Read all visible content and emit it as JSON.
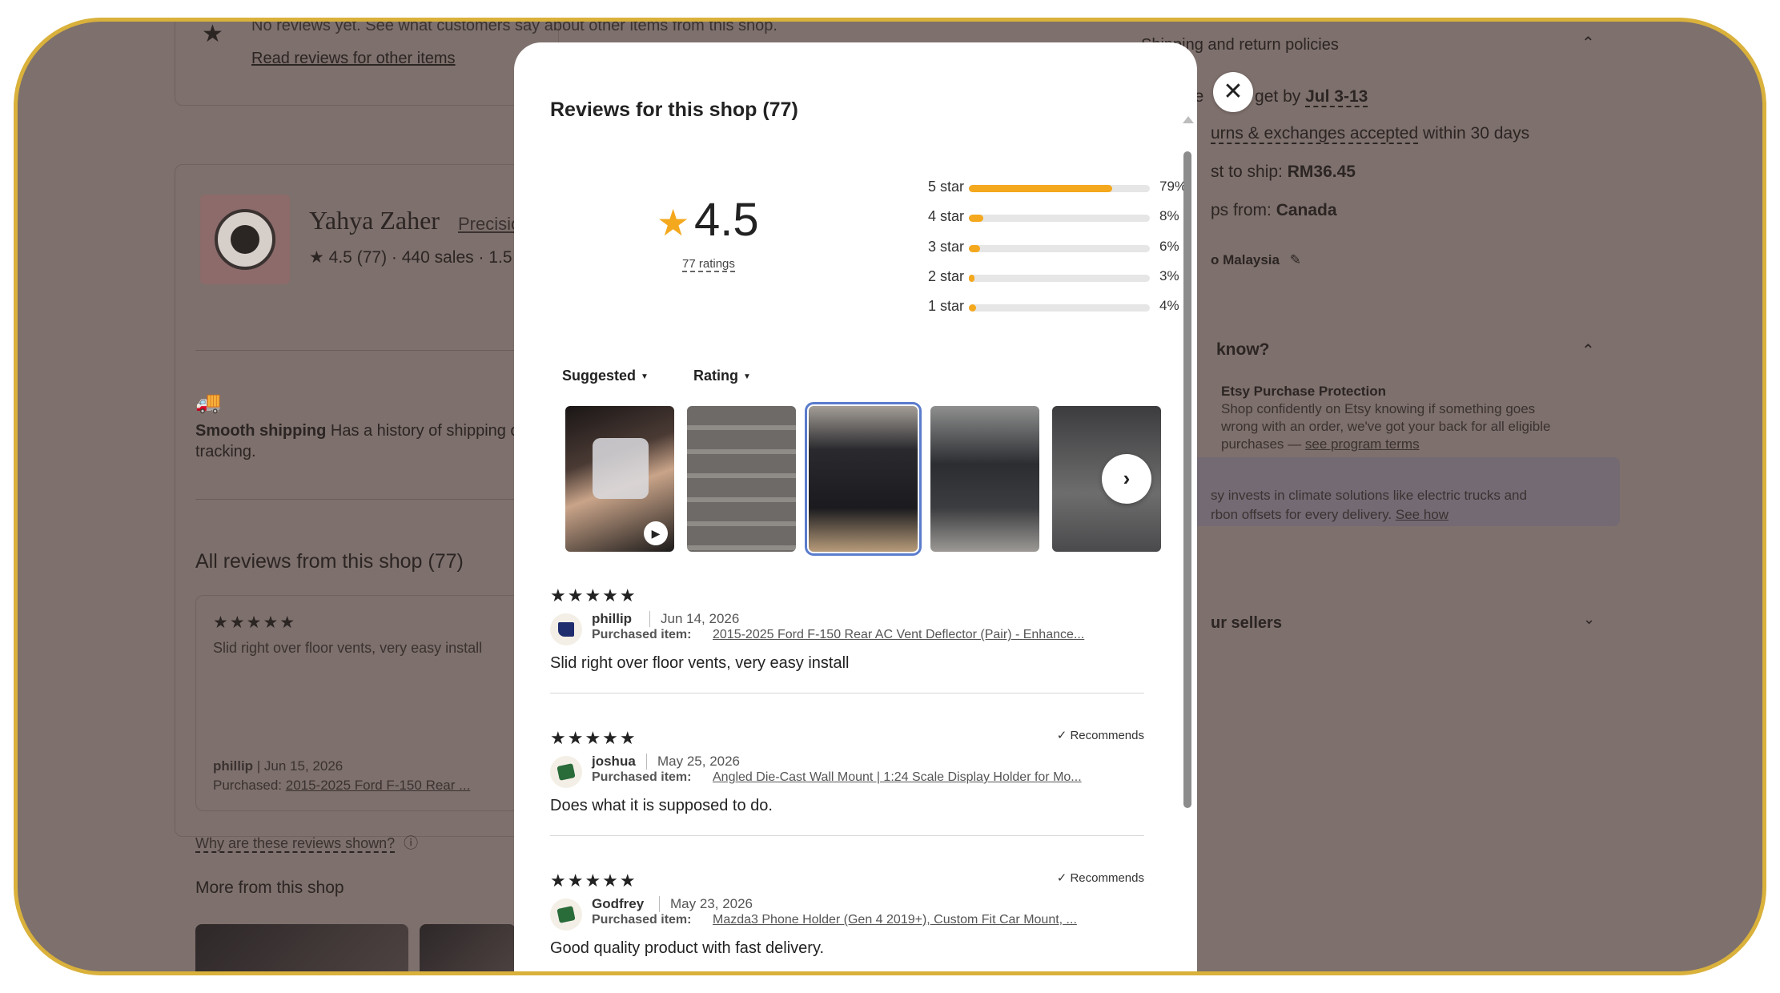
{
  "background": {
    "no_reviews_text": "No reviews yet. See what customers say about other items from this shop.",
    "read_reviews_link": "Read reviews for other items",
    "shop_name": "Yahya Zaher",
    "shop_link_partial": "Precisio",
    "shop_rating": "4.5",
    "shop_rating_count": "(77)",
    "shop_sales": "440 sales",
    "shop_extra": "1.5",
    "smooth_shipping_bold": "Smooth shipping",
    "smooth_shipping_text": "Has a history of shipping o",
    "smooth_shipping_text2": "tracking.",
    "all_reviews_title": "All reviews from this shop (77)",
    "card_review": {
      "stars": "★★★★★",
      "text": "Slid right over floor vents, very easy install",
      "name": "phillip",
      "date": "Jun 15, 2026",
      "purchased_label": "Purchased:",
      "purchased_item": "2015-2025 Ford F-150 Rear ..."
    },
    "why_shown": "Why are these reviews shown?",
    "more_from_shop": "More from this shop",
    "right_panel": {
      "shipping_policies": "Shipping and return policies",
      "order_ready": "y to get by",
      "order_ready_prefix": "le",
      "order_date": "Jul 3-13",
      "returns_link": "urns & exchanges accepted",
      "returns_suffix": "within 30 days",
      "cost_prefix": "st to ship:",
      "cost_value": "RM36.45",
      "ships_prefix": "ps from:",
      "ships_value": "Canada",
      "deliver_to": "o Malaysia",
      "did_you_know": "know?",
      "purchase_protection_title": "Etsy Purchase Protection",
      "purchase_protection_l1": "Shop confidently on Etsy knowing if something goes",
      "purchase_protection_l2": "wrong with an order, we've got your back for all eligible",
      "purchase_protection_l3": "purchases —",
      "program_terms": "see program terms",
      "climate_l1": "sy invests in climate solutions like electric trucks and",
      "climate_l2": "rbon offsets for every delivery.",
      "see_how": "See how",
      "our_sellers": "ur sellers"
    }
  },
  "modal": {
    "title": "Reviews for this shop (77)",
    "average": "4.5",
    "ratings_count": "77 ratings",
    "histogram": [
      {
        "label": "5 star",
        "percent": 79,
        "percent_text": "79%"
      },
      {
        "label": "4 star",
        "percent": 8,
        "percent_text": "8%"
      },
      {
        "label": "3 star",
        "percent": 6,
        "percent_text": "6%"
      },
      {
        "label": "2 star",
        "percent": 3,
        "percent_text": "3%"
      },
      {
        "label": "1 star",
        "percent": 4,
        "percent_text": "4%"
      }
    ],
    "sort_suggested": "Suggested",
    "sort_rating": "Rating",
    "photos": [
      "hand holding package",
      "floor vent insert",
      "phone cases",
      "truck front",
      "floor mat"
    ],
    "reviews": [
      {
        "stars": "★★★★★",
        "recommends": "",
        "name": "phillip",
        "date": "Jun 14, 2026",
        "purchased_label": "Purchased item:",
        "item": "2015-2025 Ford F-150 Rear AC Vent Deflector (Pair) - Enhance...",
        "text": "Slid right over floor vents, very easy install"
      },
      {
        "stars": "★★★★★",
        "recommends": "✓ Recommends",
        "name": "joshua",
        "date": "May 25, 2026",
        "purchased_label": "Purchased item:",
        "item": "Angled Die-Cast Wall Mount | 1:24 Scale Display Holder for Mo...",
        "text": "Does what it is supposed to do."
      },
      {
        "stars": "★★★★★",
        "recommends": "✓ Recommends",
        "name": "Godfrey",
        "date": "May 23, 2026",
        "purchased_label": "Purchased item:",
        "item": "Mazda3 Phone Holder (Gen 4 2019+), Custom Fit Car Mount, ...",
        "text": "Good quality product with fast delivery."
      }
    ]
  },
  "colors": {
    "accent_star": "#f4a81d",
    "overlay": "#7e706c",
    "frame": "#d9b13b"
  }
}
